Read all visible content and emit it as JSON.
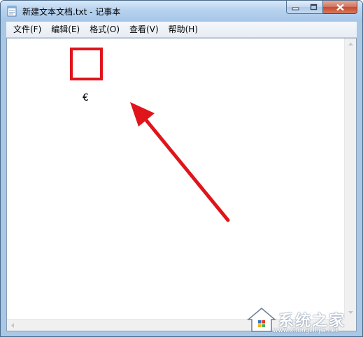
{
  "window": {
    "title": "新建文本文档.txt - 记事本",
    "app_icon": "notepad-icon"
  },
  "caption_buttons": {
    "minimize_icon": "minimize-icon",
    "maximize_icon": "maximize-icon",
    "close_icon": "close-icon"
  },
  "menu": {
    "items": [
      {
        "label": "文件(F)"
      },
      {
        "label": "编辑(E)"
      },
      {
        "label": "格式(O)"
      },
      {
        "label": "查看(V)"
      },
      {
        "label": "帮助(H)"
      }
    ]
  },
  "editor": {
    "content": "€"
  },
  "annotation": {
    "color": "#e0141b"
  },
  "watermark": {
    "text": "系统之家",
    "url": "www.xitongzhijia.net"
  }
}
